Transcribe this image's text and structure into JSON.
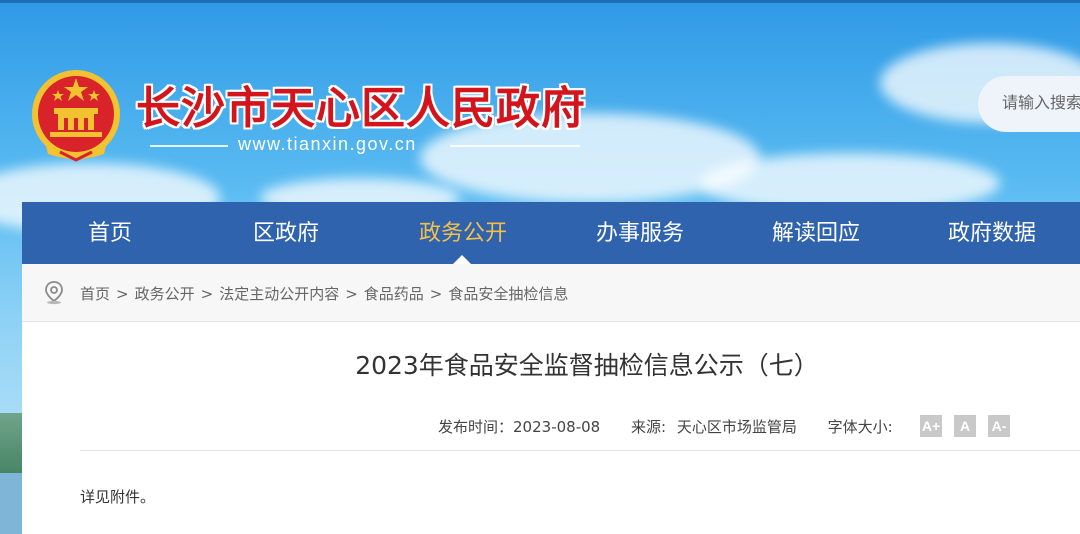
{
  "header": {
    "site_title": "长沙市天心区人民政府",
    "site_url": "www.tianxin.gov.cn",
    "search_placeholder": "请输入搜索"
  },
  "nav": {
    "items": [
      {
        "label": "首页",
        "active": false
      },
      {
        "label": "区政府",
        "active": false
      },
      {
        "label": "政务公开",
        "active": true
      },
      {
        "label": "办事服务",
        "active": false
      },
      {
        "label": "解读回应",
        "active": false
      },
      {
        "label": "政府数据",
        "active": false
      }
    ],
    "active_color": "#f5c04a",
    "bar_color": "#2f63ad"
  },
  "breadcrumb": {
    "icon": "location-pin-icon",
    "items": [
      "首页",
      "政务公开",
      "法定主动公开内容",
      "食品药品",
      "食品安全抽检信息"
    ],
    "separator": ">"
  },
  "article": {
    "title": "2023年食品安全监督抽检信息公示（七）",
    "publish_label": "发布时间：",
    "publish_date": "2023-08-08",
    "source_label": "来源:",
    "source": "天心区市场监管局",
    "font_size_label": "字体大小:",
    "font_buttons": [
      "A+",
      "A",
      "A-"
    ],
    "body": "详见附件。"
  },
  "colors": {
    "title_red": "#d4141c",
    "nav_blue": "#2f63ad"
  }
}
